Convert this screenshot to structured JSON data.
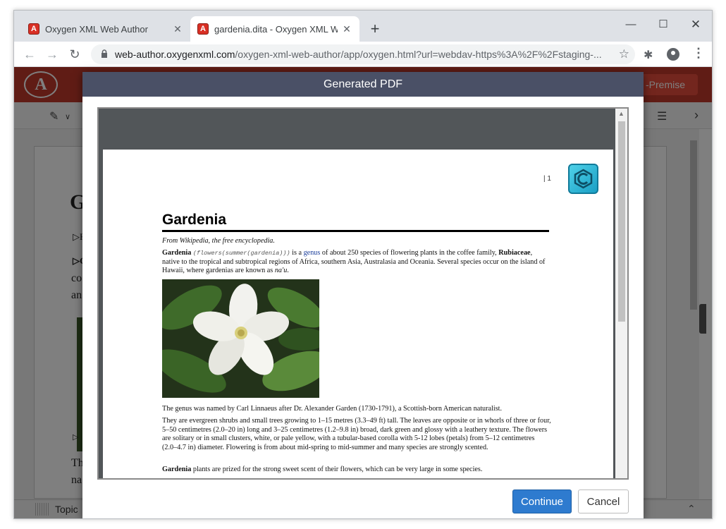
{
  "browser": {
    "tabs": [
      {
        "title": "Oxygen XML Web Author",
        "favicon": "A"
      },
      {
        "title": "gardenia.dita - Oxygen XML Web Author",
        "favicon": "A"
      }
    ],
    "new_tab": "+",
    "address_host": "web-author.oxygenxml.com",
    "address_rest": "/oxygen-xml-web-author/app/oxygen.html?url=webdav-https%3A%2F%2Fstaging-...",
    "window_controls": {
      "minimize": "—",
      "maximize": "☐",
      "close": "✕"
    }
  },
  "app": {
    "logo": "A",
    "on_premise_label": "-Premise",
    "status_topic": "Topic",
    "bg_heading": "G",
    "bg_lines": [
      "▷F",
      "▷G",
      "co",
      "an",
      "▷",
      "Th",
      "na"
    ]
  },
  "dialog": {
    "title": "Generated PDF",
    "continue_label": "Continue",
    "cancel_label": "Cancel"
  },
  "pdf": {
    "page_number": "| 1",
    "title": "Gardenia",
    "subtitle": "From Wikipedia, the free encyclopedia.",
    "para1": {
      "bold_start": "Gardenia",
      "code": "(flowers(summer(gardenia)))",
      "text_a": " is a ",
      "link": "genus",
      "text_b": " of about 250 species of flowering plants in the coffee family, ",
      "bold_family": "Rubiaceae",
      "text_c": ", native to the tropical and subtropical regions of Africa, southern Asia, Australasia and Oceania. Several species occur on the island of Hawaii, where gardenias are known as ",
      "italic_name": "na'u",
      "text_d": "."
    },
    "para2": "The genus was named by Carl Linnaeus after Dr. Alexander Garden (1730-1791), a Scottish-born American naturalist.",
    "para3": "They are evergreen shrubs and small trees growing to 1–15 metres (3.3–49 ft) tall. The leaves are opposite or in whorls of three or four, 5–50 centimetres (2.0–20 in) long and 3–25 centimetres (1.2–9.8 in) broad, dark green and glossy with a leathery texture. The flowers are solitary or in small clusters, white, or pale yellow, with a tubular-based corolla with 5-12 lobes (petals) from 5–12 centimetres (2.0–4.7 in) diameter. Flowering is from about mid-spring to mid-summer and many species are strongly scented.",
    "para4_bold": "Gardenia",
    "para4_rest": " plants are prized for the strong sweet scent of their flowers, which can be very large in some species."
  },
  "colors": {
    "app_header": "#c0392b",
    "dialog_header": "#4a5066",
    "continue_button": "#2e7bcf",
    "logo_cyan": "#4fd1e8"
  }
}
